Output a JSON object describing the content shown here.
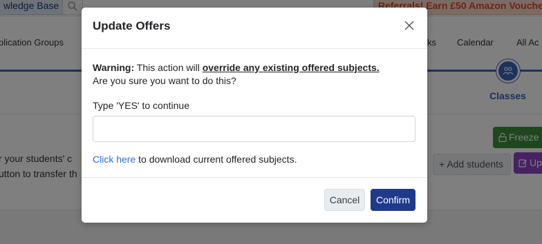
{
  "background": {
    "knowledge_base_label": "wledge Base",
    "referral_text": "Referrals! Earn £50 Amazon Vouche",
    "nav": {
      "application_groups": "plication Groups",
      "tasks_partial": "ks",
      "calendar": "Calendar",
      "all_partial": "All Ac"
    },
    "step_label": "Classes",
    "body_line1": "r your students' c",
    "body_line2": "utton to transfer th",
    "freeze_label": "Freeze",
    "add_students_label": "Add students",
    "update_label": "Up",
    "colors": {
      "primary": "#3a64b8",
      "freeze": "#3c8f3a",
      "update": "#8e44c4",
      "referral": "#d9482b"
    }
  },
  "modal": {
    "title": "Update Offers",
    "warning_prefix": "Warning:",
    "warning_text": " This action will ",
    "warning_emphasis": "override any existing offered subjects.",
    "confirm_question": "Are you sure you want to do this?",
    "type_prompt": "Type 'YES' to continue",
    "input_value": "",
    "download_link": "Click here",
    "download_suffix": " to download current offered subjects.",
    "cancel_label": "Cancel",
    "confirm_label": "Confirm",
    "confirm_color": "#1f3a8a"
  }
}
